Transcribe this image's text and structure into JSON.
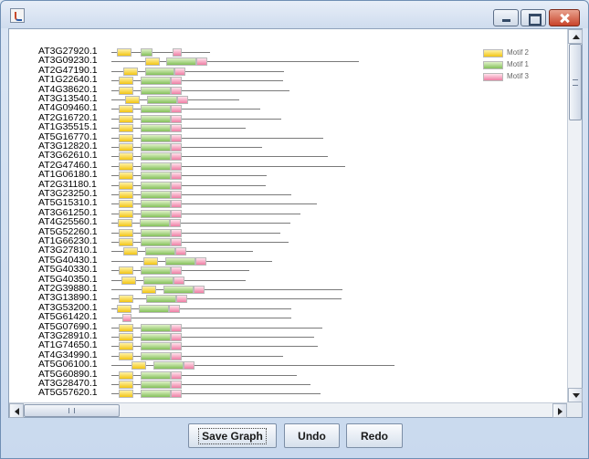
{
  "window": {
    "title": ""
  },
  "legend": [
    {
      "label": "Motif 2",
      "color": "#f2c514"
    },
    {
      "label": "Motif 1",
      "color": "#84c05a"
    },
    {
      "label": "Motif 3",
      "color": "#ee7fa4"
    }
  ],
  "genes": [
    {
      "name": "AT3G27920.1",
      "length": 108,
      "motifs": [
        [
          "m2",
          6,
          22
        ],
        [
          "m1",
          32,
          45
        ],
        [
          "m3",
          67,
          77
        ]
      ]
    },
    {
      "name": "AT3G09230.1",
      "length": 271,
      "motifs": [
        [
          "m2",
          37,
          53
        ],
        [
          "m1",
          60,
          93
        ],
        [
          "m3",
          93,
          105
        ]
      ]
    },
    {
      "name": "AT2G47190.1",
      "length": 189,
      "motifs": [
        [
          "m2",
          13,
          29
        ],
        [
          "m1",
          37,
          69
        ],
        [
          "m3",
          69,
          81
        ]
      ]
    },
    {
      "name": "AT1G22640.1",
      "length": 188,
      "motifs": [
        [
          "m2",
          8,
          24
        ],
        [
          "m1",
          32,
          65
        ],
        [
          "m3",
          65,
          77
        ]
      ]
    },
    {
      "name": "AT4G38620.1",
      "length": 195,
      "motifs": [
        [
          "m2",
          8,
          24
        ],
        [
          "m1",
          32,
          65
        ],
        [
          "m3",
          65,
          77
        ]
      ]
    },
    {
      "name": "AT3G13540.1",
      "length": 140,
      "motifs": [
        [
          "m2",
          15,
          31
        ],
        [
          "m1",
          39,
          72
        ],
        [
          "m3",
          72,
          84
        ]
      ]
    },
    {
      "name": "AT4G09460.1",
      "length": 163,
      "motifs": [
        [
          "m2",
          8,
          24
        ],
        [
          "m1",
          32,
          65
        ],
        [
          "m3",
          65,
          77
        ]
      ]
    },
    {
      "name": "AT2G16720.1",
      "length": 186,
      "motifs": [
        [
          "m2",
          8,
          24
        ],
        [
          "m1",
          32,
          65
        ],
        [
          "m3",
          65,
          77
        ]
      ]
    },
    {
      "name": "AT1G35515.1",
      "length": 147,
      "motifs": [
        [
          "m2",
          8,
          24
        ],
        [
          "m1",
          32,
          65
        ],
        [
          "m3",
          65,
          77
        ]
      ]
    },
    {
      "name": "AT5G16770.1",
      "length": 232,
      "motifs": [
        [
          "m2",
          8,
          24
        ],
        [
          "m1",
          32,
          65
        ],
        [
          "m3",
          65,
          77
        ]
      ]
    },
    {
      "name": "AT3G12820.1",
      "length": 165,
      "motifs": [
        [
          "m2",
          8,
          24
        ],
        [
          "m1",
          32,
          65
        ],
        [
          "m3",
          65,
          77
        ]
      ]
    },
    {
      "name": "AT3G62610.1",
      "length": 237,
      "motifs": [
        [
          "m2",
          8,
          24
        ],
        [
          "m1",
          32,
          65
        ],
        [
          "m3",
          65,
          77
        ]
      ]
    },
    {
      "name": "AT2G47460.1",
      "length": 256,
      "motifs": [
        [
          "m2",
          8,
          24
        ],
        [
          "m1",
          32,
          65
        ],
        [
          "m3",
          65,
          77
        ]
      ]
    },
    {
      "name": "AT1G06180.1",
      "length": 170,
      "motifs": [
        [
          "m2",
          8,
          24
        ],
        [
          "m1",
          32,
          65
        ],
        [
          "m3",
          65,
          77
        ]
      ]
    },
    {
      "name": "AT2G31180.1",
      "length": 169,
      "motifs": [
        [
          "m2",
          8,
          24
        ],
        [
          "m1",
          32,
          65
        ],
        [
          "m3",
          65,
          77
        ]
      ]
    },
    {
      "name": "AT3G23250.1",
      "length": 197,
      "motifs": [
        [
          "m2",
          8,
          24
        ],
        [
          "m1",
          32,
          65
        ],
        [
          "m3",
          65,
          77
        ]
      ]
    },
    {
      "name": "AT5G15310.1",
      "length": 225,
      "motifs": [
        [
          "m2",
          8,
          24
        ],
        [
          "m1",
          32,
          65
        ],
        [
          "m3",
          65,
          77
        ]
      ]
    },
    {
      "name": "AT3G61250.1",
      "length": 207,
      "motifs": [
        [
          "m2",
          8,
          24
        ],
        [
          "m1",
          32,
          65
        ],
        [
          "m3",
          65,
          77
        ]
      ]
    },
    {
      "name": "AT4G25560.1",
      "length": 196,
      "motifs": [
        [
          "m2",
          7,
          23
        ],
        [
          "m1",
          31,
          64
        ],
        [
          "m3",
          64,
          76
        ]
      ]
    },
    {
      "name": "AT5G52260.1",
      "length": 185,
      "motifs": [
        [
          "m2",
          8,
          24
        ],
        [
          "m1",
          32,
          65
        ],
        [
          "m3",
          65,
          77
        ]
      ]
    },
    {
      "name": "AT1G66230.1",
      "length": 194,
      "motifs": [
        [
          "m2",
          8,
          24
        ],
        [
          "m1",
          32,
          65
        ],
        [
          "m3",
          65,
          77
        ]
      ]
    },
    {
      "name": "AT3G27810.1",
      "length": 155,
      "motifs": [
        [
          "m2",
          13,
          29
        ],
        [
          "m1",
          37,
          70
        ],
        [
          "m3",
          70,
          82
        ]
      ]
    },
    {
      "name": "AT5G40430.1",
      "length": 176,
      "motifs": [
        [
          "m2",
          35,
          51
        ],
        [
          "m1",
          59,
          92
        ],
        [
          "m3",
          92,
          104
        ]
      ]
    },
    {
      "name": "AT5G40330.1",
      "length": 151,
      "motifs": [
        [
          "m2",
          8,
          24
        ],
        [
          "m1",
          32,
          65
        ],
        [
          "m3",
          65,
          77
        ]
      ]
    },
    {
      "name": "AT5G40350.1",
      "length": 147,
      "motifs": [
        [
          "m2",
          11,
          27
        ],
        [
          "m1",
          35,
          68
        ],
        [
          "m3",
          68,
          80
        ]
      ]
    },
    {
      "name": "AT2G39880.1",
      "length": 253,
      "motifs": [
        [
          "m2",
          33,
          49
        ],
        [
          "m1",
          57,
          90
        ],
        [
          "m3",
          90,
          102
        ]
      ]
    },
    {
      "name": "AT3G13890.1",
      "length": 252,
      "motifs": [
        [
          "m2",
          8,
          24
        ],
        [
          "m1",
          38,
          71
        ],
        [
          "m3",
          71,
          83
        ]
      ]
    },
    {
      "name": "AT3G53200.1",
      "length": 197,
      "motifs": [
        [
          "m2",
          6,
          22
        ],
        [
          "m1",
          30,
          63
        ],
        [
          "m3",
          63,
          75
        ]
      ]
    },
    {
      "name": "AT5G61420.1",
      "length": 197,
      "motifs": [
        [
          "m3",
          12,
          22
        ]
      ]
    },
    {
      "name": "AT5G07690.1",
      "length": 231,
      "motifs": [
        [
          "m2",
          8,
          24
        ],
        [
          "m1",
          32,
          65
        ],
        [
          "m3",
          65,
          77
        ]
      ]
    },
    {
      "name": "AT3G28910.1",
      "length": 222,
      "motifs": [
        [
          "m2",
          8,
          24
        ],
        [
          "m1",
          32,
          65
        ],
        [
          "m3",
          65,
          77
        ]
      ]
    },
    {
      "name": "AT1G74650.1",
      "length": 226,
      "motifs": [
        [
          "m2",
          8,
          24
        ],
        [
          "m1",
          32,
          65
        ],
        [
          "m3",
          65,
          77
        ]
      ]
    },
    {
      "name": "AT4G34990.1",
      "length": 188,
      "motifs": [
        [
          "m2",
          8,
          24
        ],
        [
          "m1",
          32,
          65
        ],
        [
          "m3",
          65,
          77
        ]
      ]
    },
    {
      "name": "AT5G06100.1",
      "length": 310,
      "motifs": [
        [
          "m2",
          22,
          38
        ],
        [
          "m1",
          46,
          79
        ],
        [
          "m3",
          79,
          91
        ]
      ]
    },
    {
      "name": "AT5G60890.1",
      "length": 203,
      "motifs": [
        [
          "m2",
          8,
          24
        ],
        [
          "m1",
          32,
          65
        ],
        [
          "m3",
          65,
          77
        ]
      ]
    },
    {
      "name": "AT3G28470.1",
      "length": 218,
      "motifs": [
        [
          "m2",
          8,
          24
        ],
        [
          "m1",
          32,
          65
        ],
        [
          "m3",
          65,
          77
        ]
      ]
    },
    {
      "name": "AT5G57620.1",
      "length": 229,
      "motifs": [
        [
          "m2",
          8,
          24
        ],
        [
          "m1",
          32,
          65
        ],
        [
          "m3",
          65,
          77
        ]
      ]
    }
  ],
  "buttons": {
    "save": "Save Graph",
    "undo": "Undo",
    "redo": "Redo"
  }
}
